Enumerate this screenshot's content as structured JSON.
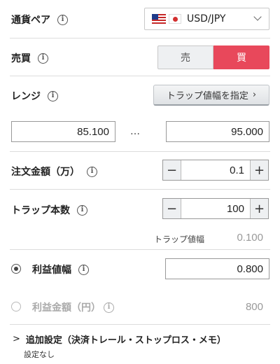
{
  "pair": {
    "label": "通貨ペア",
    "value": "USD/JPY"
  },
  "side": {
    "label": "売買",
    "sell": "売",
    "buy": "買",
    "selected": "buy",
    "buy_color": "#e8485b"
  },
  "range": {
    "label": "レンジ",
    "button": "トラップ値幅を指定",
    "button_arrow": "›",
    "low": "85.100",
    "high": "95.000",
    "separator": "…"
  },
  "amount": {
    "label": "注文金額（万）",
    "value": "0.1",
    "minus": "−",
    "plus": "+"
  },
  "trap_count": {
    "label": "トラップ本数",
    "value": "100",
    "minus": "−",
    "plus": "+"
  },
  "trap_width": {
    "label": "トラップ値幅",
    "value": "0.100"
  },
  "profit_width": {
    "label": "利益値幅",
    "value": "0.800",
    "selected": true
  },
  "profit_amount": {
    "label": "利益金額（円）",
    "value": "800",
    "selected": false
  },
  "advanced": {
    "arrow": ">",
    "label": "追加設定（決済トレール・ストップロス・メモ）",
    "sub": "設定なし"
  },
  "icons": {
    "info": "i"
  }
}
